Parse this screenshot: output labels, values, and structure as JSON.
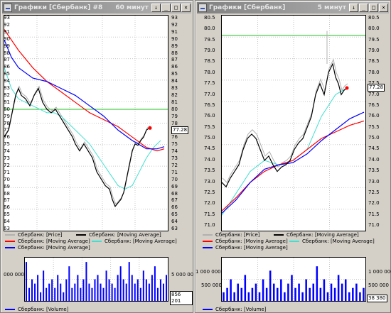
{
  "left": {
    "title": "Графики [Сбербанк] #8",
    "title_extra": "60 минут",
    "axis_labels": [
      "93",
      "92",
      "91",
      "90",
      "89",
      "88",
      "87",
      "86",
      "85",
      "84",
      "83",
      "82",
      "81",
      "80",
      "79",
      "78",
      "77",
      "76",
      "75",
      "74",
      "73",
      "72",
      "71",
      "70",
      "69",
      "68",
      "67",
      "66",
      "65",
      "64",
      "63"
    ],
    "price_tag": "77.28",
    "legend": [
      {
        "label": "Сбербанк: [Price]",
        "color": "#b0b0b0"
      },
      {
        "label": "Сбербанк: [Moving Average]",
        "color": "#000000"
      },
      {
        "label": "Сбербанк: [Moving Average]",
        "color": "#ff0000"
      },
      {
        "label": "Сбербанк: [Moving Average]",
        "color": "#40e0d0"
      },
      {
        "label": "Сбербанк: [Moving Average]",
        "color": "#0000ff"
      }
    ],
    "vol_axis_left": "000 000",
    "vol_axis_right": "5 000 00",
    "vol_tag": "856 201",
    "vol_legend": "Сбербанк: [Volume]"
  },
  "right": {
    "title": "Графики [Сбербанк]",
    "title_extra": "5 минут",
    "axis_labels": [
      "80.5",
      "80.0",
      "79.5",
      "79.0",
      "78.5",
      "78.0",
      "77.5",
      "77.0",
      "76.5",
      "76.0",
      "75.5",
      "75.0",
      "74.5",
      "74.0",
      "73.5",
      "73.0",
      "72.5",
      "72.0",
      "71.5",
      "71.0"
    ],
    "price_tag": "77.28",
    "legend": [
      {
        "label": "Сбербанк: [Price]",
        "color": "#b0b0b0"
      },
      {
        "label": "Сбербанк: [Moving Average]",
        "color": "#000000"
      },
      {
        "label": "Сбербанк: [Moving Average]",
        "color": "#ff0000"
      },
      {
        "label": "Сбербанк: [Moving Average]",
        "color": "#40e0d0"
      },
      {
        "label": "Сбербанк: [Moving Average]",
        "color": "#0000ff"
      }
    ],
    "vol_axis_left": [
      "1 000 000",
      "500 000"
    ],
    "vol_axis_right": [
      "1 000 000",
      "500 000"
    ],
    "vol_tag": "38 380",
    "vol_legend": "Сбербанк: [Volume]"
  }
}
